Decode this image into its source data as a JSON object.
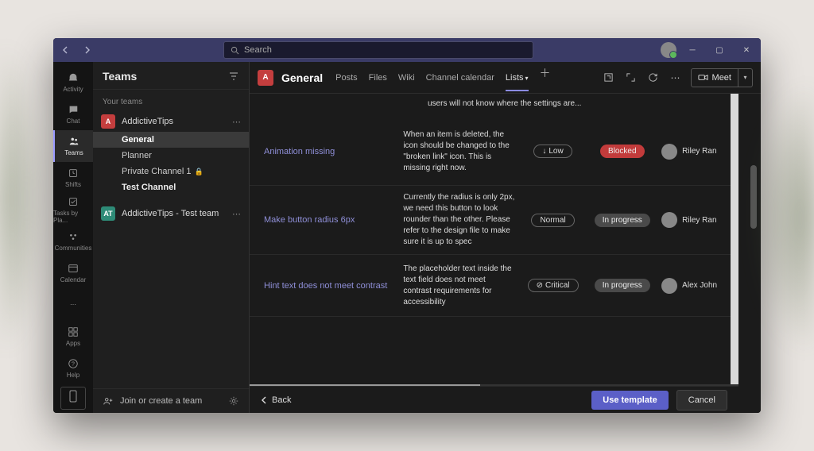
{
  "search": {
    "placeholder": "Search"
  },
  "rail": {
    "items": [
      {
        "label": "Activity"
      },
      {
        "label": "Chat"
      },
      {
        "label": "Teams"
      },
      {
        "label": "Shifts"
      },
      {
        "label": "Tasks by Pla..."
      },
      {
        "label": "Communities"
      },
      {
        "label": "Calendar"
      }
    ],
    "apps": "Apps",
    "help": "Help"
  },
  "sidepanel": {
    "title": "Teams",
    "your_teams": "Your teams",
    "teams": [
      {
        "initial": "A",
        "name": "AddictiveTips",
        "channels": [
          "General",
          "Planner",
          "Private Channel 1",
          "Test Channel"
        ],
        "private_idx": 2
      },
      {
        "initial": "AT",
        "name": "AddictiveTips - Test team"
      }
    ],
    "join": "Join or create a team"
  },
  "chead": {
    "badge": "A",
    "title": "General",
    "tabs": [
      "Posts",
      "Files",
      "Wiki",
      "Channel calendar",
      "Lists"
    ],
    "meet": "Meet"
  },
  "rows": {
    "partial_desc": "users will not know where the settings are...",
    "r1": {
      "title": "Animation missing",
      "desc": "When an item is deleted, the icon should be changed to the \"broken link\" icon. This is missing right now.",
      "priority": "Low",
      "status": "Blocked",
      "assignee": "Riley Ran"
    },
    "r2": {
      "title": "Make button radius 6px",
      "desc": "Currently the radius is only 2px, we need this button to look rounder than the other. Please refer to the design file to make sure it is up to spec",
      "priority": "Normal",
      "status": "In progress",
      "assignee": "Riley Ran"
    },
    "r3": {
      "title": "Hint text does not meet contrast",
      "desc": "The placeholder text inside the text field does not meet contrast requirements for accessibility",
      "priority": "Critical",
      "status": "In progress",
      "assignee": "Alex John"
    }
  },
  "footer": {
    "back": "Back",
    "use_template": "Use template",
    "cancel": "Cancel"
  }
}
